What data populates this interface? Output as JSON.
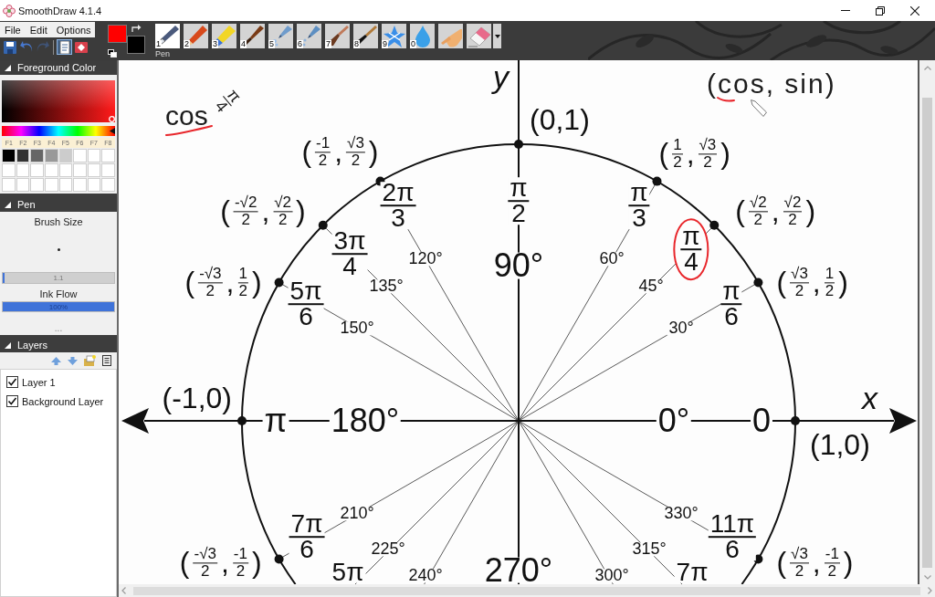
{
  "window": {
    "title": "SmoothDraw 4.1.4"
  },
  "menu": [
    "File",
    "Edit",
    "Options"
  ],
  "quick_actions": [
    {
      "kind": "save",
      "disabled": false,
      "selected": false
    },
    {
      "kind": "undo",
      "disabled": false,
      "selected": false
    },
    {
      "kind": "redo",
      "disabled": true,
      "selected": false
    },
    {
      "kind": "page",
      "disabled": false,
      "selected": true
    },
    {
      "kind": "screen",
      "disabled": false,
      "selected": false
    }
  ],
  "colors": [
    {
      "kind": "foreground",
      "color": "#ff0000"
    },
    {
      "kind": "background",
      "color": "#000000"
    }
  ],
  "tools": [
    {
      "number": "1",
      "kind": "pen",
      "selected": true,
      "caption": "Pen"
    },
    {
      "number": "2",
      "kind": "pencil",
      "selected": false
    },
    {
      "number": "3",
      "kind": "highlighter",
      "selected": false
    },
    {
      "number": "4",
      "kind": "brush",
      "selected": false
    },
    {
      "number": "5",
      "kind": "airbrush",
      "selected": false
    },
    {
      "number": "6",
      "kind": "spray",
      "selected": false
    },
    {
      "number": "7",
      "kind": "flat_brush",
      "selected": false
    },
    {
      "number": "8",
      "kind": "ink_brush",
      "selected": false
    },
    {
      "number": "9",
      "kind": "splash",
      "selected": false
    },
    {
      "number": "0",
      "kind": "drop",
      "selected": false
    },
    {
      "kind": "hand",
      "selected": false
    },
    {
      "kind": "eraser",
      "selected": false
    }
  ],
  "left_panel": {
    "foreground_color": {
      "title": "Foreground Color",
      "expanded": true,
      "hue": {
        "level": 1
      },
      "keys": [
        "F1",
        "F2",
        "F3",
        "F4",
        "F5",
        "F6",
        "F7",
        "F8"
      ],
      "palette": [
        {
          "color": "#000000"
        },
        {
          "color": "#333333"
        },
        {
          "color": "#666666"
        },
        {
          "color": "#999999"
        },
        {
          "color": "#cccccc"
        },
        {
          "color": "#ffffff"
        },
        {
          "color": "#ffffff"
        },
        {
          "color": "#ffffff"
        },
        {
          "color": "#ffffff"
        },
        {
          "color": "#ffffff"
        },
        {
          "color": "#ffffff"
        },
        {
          "color": "#ffffff"
        },
        {
          "color": "#ffffff"
        },
        {
          "color": "#ffffff"
        },
        {
          "color": "#ffffff"
        },
        {
          "color": "#ffffff"
        },
        {
          "color": "#ffffff"
        },
        {
          "color": "#ffffff"
        },
        {
          "color": "#ffffff"
        },
        {
          "color": "#ffffff"
        },
        {
          "color": "#ffffff"
        },
        {
          "color": "#ffffff"
        },
        {
          "color": "#ffffff"
        },
        {
          "color": "#ffffff"
        }
      ]
    },
    "pen": {
      "title": "Pen",
      "expanded": true,
      "brush_size": {
        "label": "Brush Size",
        "level": 0.02,
        "reading": "1.1"
      },
      "ink_flow": {
        "label": "Ink Flow",
        "level": 1,
        "reading": "100%"
      },
      "more": "..."
    },
    "layers": {
      "title": "Layers",
      "expanded": true,
      "items": [
        {
          "name": "Layer 1",
          "checked": true
        },
        {
          "name": "Background Layer",
          "checked": true
        }
      ]
    }
  },
  "canvas": {
    "axes": [
      {
        "kind": "y",
        "label": "y"
      },
      {
        "kind": "x",
        "label": "x"
      }
    ],
    "points": [
      {
        "parts": [
          "(0,1)"
        ]
      },
      {
        "parts": [
          "(",
          {
            "num": "-1",
            "den": "2"
          },
          ",",
          {
            "num": "√3",
            "den": "2"
          },
          ")"
        ]
      },
      {
        "parts": [
          "(",
          {
            "num": "1",
            "den": "2"
          },
          ",",
          {
            "num": "√3",
            "den": "2"
          },
          ")"
        ]
      },
      {
        "parts": [
          "(",
          {
            "num": "-√2",
            "den": "2"
          },
          ",",
          {
            "num": "√2",
            "den": "2"
          },
          ")"
        ]
      },
      {
        "parts": [
          "(",
          {
            "num": "√2",
            "den": "2"
          },
          ",",
          {
            "num": "√2",
            "den": "2"
          },
          ")"
        ]
      },
      {
        "parts": [
          "(",
          {
            "num": "-√3",
            "den": "2"
          },
          ",",
          {
            "num": "1",
            "den": "2"
          },
          ")"
        ]
      },
      {
        "parts": [
          "(",
          {
            "num": "√3",
            "den": "2"
          },
          ",",
          {
            "num": "1",
            "den": "2"
          },
          ")"
        ]
      },
      {
        "parts": [
          "(-1,0)"
        ]
      },
      {
        "parts": [
          "(1,0)"
        ]
      },
      {
        "parts": [
          "(",
          {
            "num": "-√3",
            "den": "2"
          },
          ",",
          {
            "num": "-1",
            "den": "2"
          },
          ")"
        ]
      },
      {
        "parts": [
          "(",
          {
            "num": "√3",
            "den": "2"
          },
          ",",
          {
            "num": "-1",
            "den": "2"
          },
          ")"
        ]
      }
    ],
    "radians": [
      {
        "num": "2π",
        "den": "3",
        "circled": false
      },
      {
        "num": "π",
        "den": "2",
        "circled": false
      },
      {
        "num": "π",
        "den": "3",
        "circled": false
      },
      {
        "num": "3π",
        "den": "4",
        "circled": false
      },
      {
        "num": "π",
        "den": "4",
        "circled": true
      },
      {
        "num": "5π",
        "den": "6",
        "circled": false
      },
      {
        "num": "π",
        "den": "6",
        "circled": false
      },
      {
        "text": "π",
        "circled": false
      },
      {
        "text": "0",
        "circled": false
      },
      {
        "num": "7π",
        "den": "6",
        "circled": false
      },
      {
        "num": "11π",
        "den": "6",
        "circled": false
      },
      {
        "num": "5π",
        "circled": false
      },
      {
        "num": "7π",
        "circled": false
      }
    ],
    "degrees": [
      "120°",
      "90°",
      "60°",
      "135°",
      "45°",
      "150°",
      "30°",
      "180°",
      "0°",
      "210°",
      "330°",
      "225°",
      "315°",
      "240°",
      "270°",
      "300°"
    ],
    "notes": [
      {
        "text": "cos",
        "fraction": {
          "num": "π",
          "den": "4"
        },
        "underlined": true
      },
      {
        "text": "(cos, sin)",
        "underlined": true
      }
    ]
  }
}
